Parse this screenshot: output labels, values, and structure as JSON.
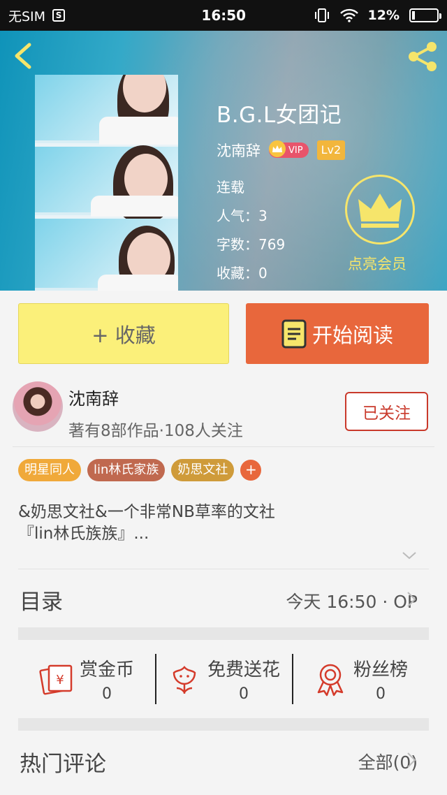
{
  "status_bar": {
    "carrier": "无SIM",
    "time": "16:50",
    "battery": "12%"
  },
  "book": {
    "title": "B.G.L女团记",
    "author": "沈南辞",
    "vip_badge": "VIP",
    "level": "Lv2",
    "serial_status": "连载",
    "popularity_label": "人气：",
    "popularity": "3",
    "word_count_label": "字数：",
    "word_count": "769",
    "favorites_label": "收藏：",
    "favorites": "0"
  },
  "vip": {
    "label": "点亮会员"
  },
  "actions": {
    "collect_label": "+ 收藏",
    "read_label": "开始阅读"
  },
  "author_info": {
    "name": "沈南辞",
    "meta": "著有8部作品·108人关注",
    "follow_label": "已关注"
  },
  "tags": [
    {
      "label": "明星同人",
      "color": "#f0a93a"
    },
    {
      "label": "lin林氏家族",
      "color": "#c0694f"
    },
    {
      "label": "奶思文社",
      "color": "#cf9b3a"
    }
  ],
  "tag_add": "+",
  "intro": {
    "line1": "&奶思文社&一个非常NB草率的文社",
    "line2": "『lin林氏族族』..."
  },
  "toc": {
    "title": "目录",
    "info": "今天 16:50 · OP"
  },
  "rewards": [
    {
      "label": "赏金币",
      "count": "0",
      "icon": "coin-envelope-icon"
    },
    {
      "label": "免费送花",
      "count": "0",
      "icon": "flower-icon"
    },
    {
      "label": "粉丝榜",
      "count": "0",
      "icon": "medal-icon"
    }
  ],
  "comments": {
    "title": "热门评论",
    "all_label": "全部(0)"
  },
  "colors": {
    "accent_orange": "#e8673c",
    "collect_yellow": "#fbf07a",
    "follow_red": "#c9392b",
    "vip_yellow": "#f6e56b"
  }
}
